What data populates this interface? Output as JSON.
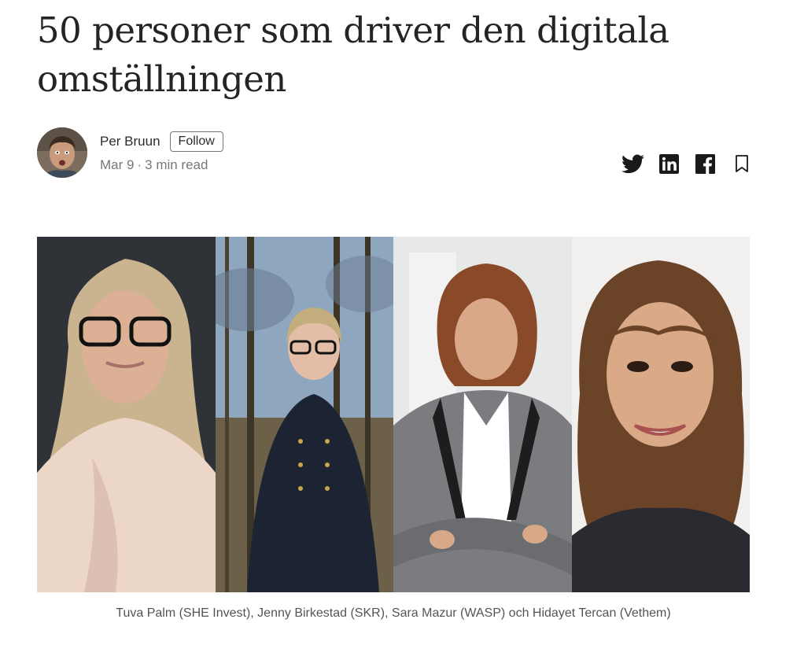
{
  "article": {
    "title": "50 personer som driver den digitala omställningen"
  },
  "author": {
    "name": "Per Bruun",
    "follow_label": "Follow",
    "date": "Mar 9",
    "separator": "·",
    "read_time": "3 min read"
  },
  "share": {
    "icons": [
      "twitter-icon",
      "linkedin-icon",
      "facebook-icon",
      "bookmark-icon"
    ]
  },
  "figure": {
    "caption": "Tuva Palm (SHE Invest), Jenny Birkestad (SKR), Sara Mazur (WASP) och Hidayet Tercan (Vethem)"
  },
  "colors": {
    "text": "#242424",
    "muted": "#757575"
  }
}
